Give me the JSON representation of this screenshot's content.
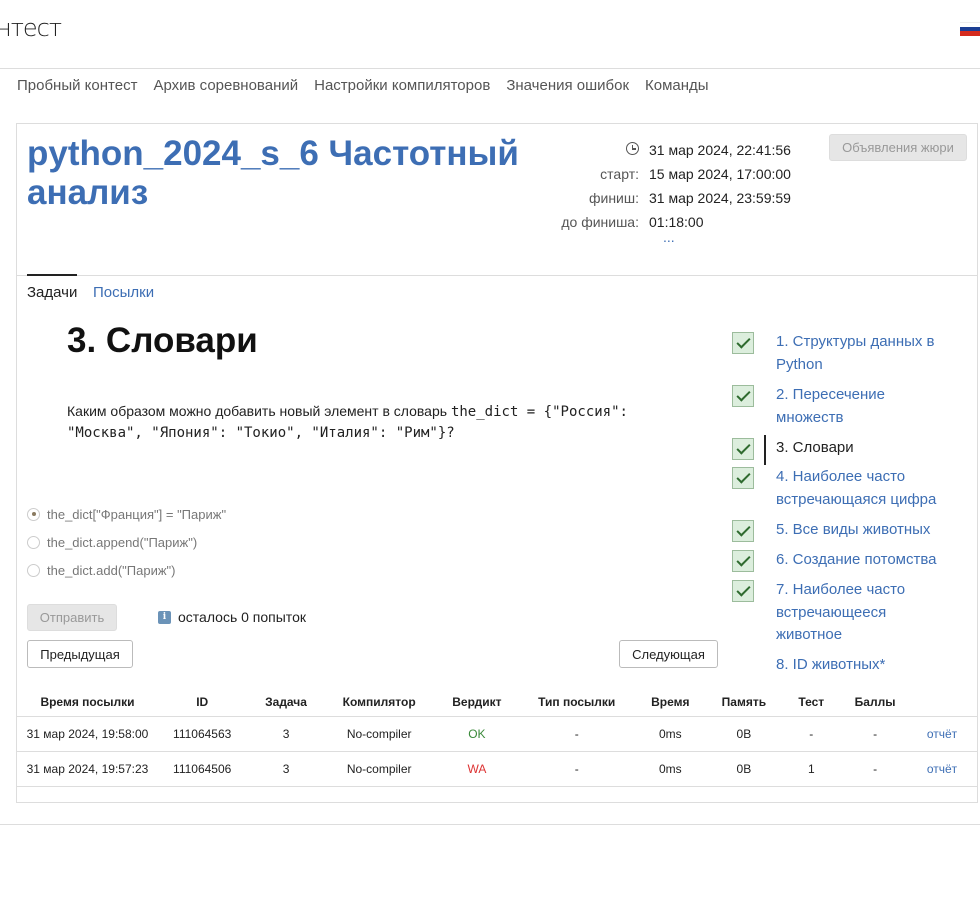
{
  "header": {
    "logo": "нтест",
    "flag_colors": [
      "#ffffff",
      "#1c3f94",
      "#d52b1e"
    ]
  },
  "nav": [
    "Пробный контест",
    "Архив соревнований",
    "Настройки компиляторов",
    "Значения ошибок",
    "Команды"
  ],
  "contest": {
    "title": "python_2024_s_6 Частотный анализ",
    "now": "31 мар 2024, 22:41:56",
    "start_label": "старт:",
    "start": "15 мар 2024, 17:00:00",
    "finish_label": "финиш:",
    "finish": "31 мар 2024, 23:59:59",
    "left_label": "до финиша:",
    "left": "01:18:00",
    "more": "...",
    "jury_button": "Объявления жюри"
  },
  "tabs": [
    "Задачи",
    "Посылки"
  ],
  "problem": {
    "title": "3. Словари",
    "question_text": "Каким образом можно добавить новый элемент в словарь ",
    "question_code": "the_dict = {\"Россия\": \"Москва\", \"Япония\": \"Токио\", \"Италия\": \"Рим\"}?",
    "options": [
      {
        "label": "the_dict[\"Франция\"] = \"Париж\"",
        "selected": true
      },
      {
        "label": "the_dict.append(\"Париж\")",
        "selected": false
      },
      {
        "label": "the_dict.add(\"Париж\")",
        "selected": false
      }
    ],
    "submit": "Отправить",
    "attempts": "осталось 0 попыток",
    "prev": "Предыдущая",
    "next": "Следующая"
  },
  "problem_list": [
    {
      "label": "1. Структуры данных в Python",
      "checked": true,
      "current": false
    },
    {
      "label": "2. Пересечение множеств",
      "checked": true,
      "current": false
    },
    {
      "label": "3. Словари",
      "checked": true,
      "current": true
    },
    {
      "label": "4. Наиболее часто встречающаяся цифра",
      "checked": true,
      "current": false
    },
    {
      "label": "5. Все виды животных",
      "checked": true,
      "current": false
    },
    {
      "label": "6. Создание потомства",
      "checked": true,
      "current": false
    },
    {
      "label": "7. Наиболее часто встречающееся животное",
      "checked": true,
      "current": false
    },
    {
      "label": "8. ID животных*",
      "checked": false,
      "current": false
    }
  ],
  "submissions": {
    "headers": [
      "Время посылки",
      "ID",
      "Задача",
      "Компилятор",
      "Вердикт",
      "Тип посылки",
      "Время",
      "Память",
      "Тест",
      "Баллы",
      ""
    ],
    "rows": [
      [
        "31 мар 2024, 19:58:00",
        "111064563",
        "3",
        "No-compiler",
        "OK",
        "-",
        "0ms",
        "0B",
        "-",
        "-",
        "отчёт"
      ],
      [
        "31 мар 2024, 19:57:23",
        "111064506",
        "3",
        "No-compiler",
        "WA",
        "-",
        "0ms",
        "0B",
        "1",
        "-",
        "отчёт"
      ]
    ]
  }
}
